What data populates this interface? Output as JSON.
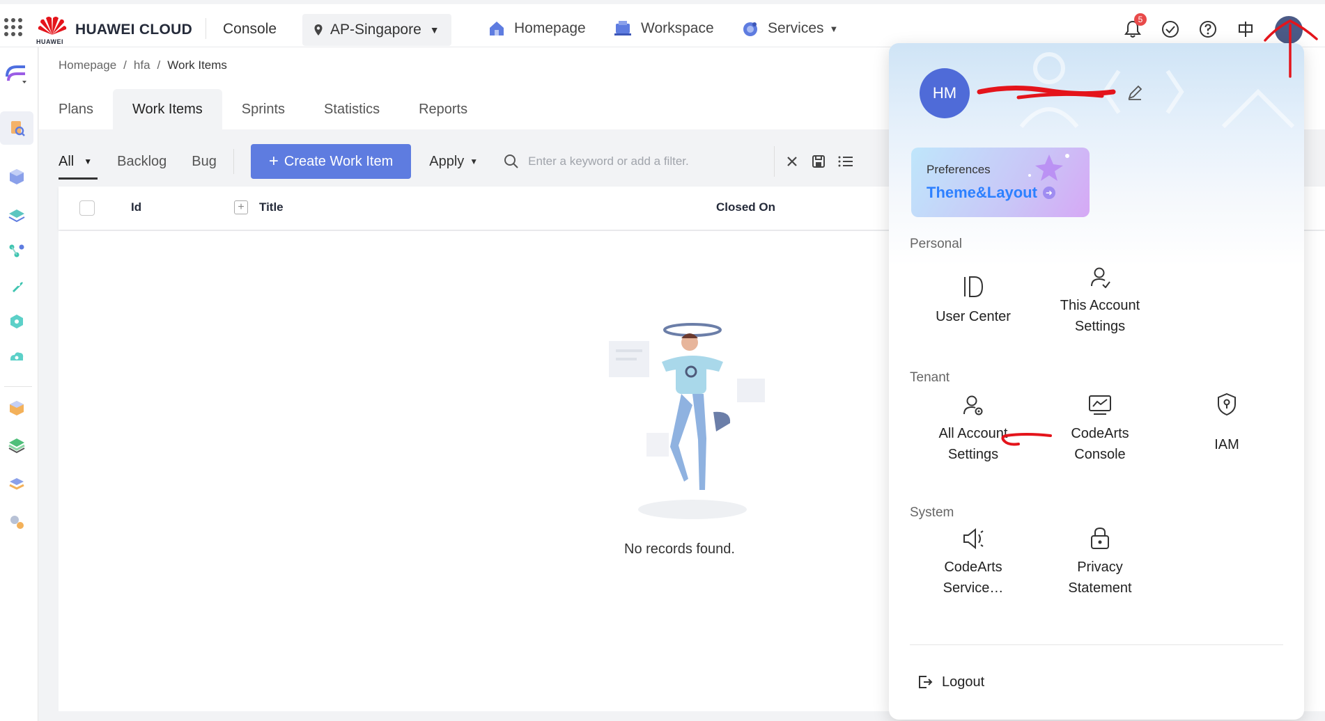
{
  "topbar": {
    "brand": "HUAWEI CLOUD",
    "logo_text": "HUAWEI",
    "console": "Console",
    "region": "AP-Singapore",
    "nav": [
      {
        "label": "Homepage"
      },
      {
        "label": "Workspace"
      },
      {
        "label": "Services"
      }
    ],
    "notification_count": "5"
  },
  "breadcrumb": {
    "items": [
      "Homepage",
      "hfa",
      "Work Items"
    ],
    "separator": "/"
  },
  "tabs": [
    "Plans",
    "Work Items",
    "Sprints",
    "Statistics",
    "Reports"
  ],
  "filter": {
    "types": [
      "All",
      "Backlog",
      "Bug"
    ],
    "create_label": "Create Work Item",
    "apply_label": "Apply",
    "search_placeholder": "Enter a keyword or add a filter."
  },
  "table": {
    "columns": [
      "Id",
      "Title",
      "Closed On"
    ],
    "empty_text": "No records found."
  },
  "popup": {
    "avatar_initials": "HM",
    "preferences_label": "Preferences",
    "theme_label": "Theme&Layout",
    "sections": {
      "personal": "Personal",
      "tenant": "Tenant",
      "system": "System"
    },
    "personal_items": [
      "User Center",
      "This Account Settings"
    ],
    "tenant_items": [
      "All Account Settings",
      "CodeArts Console",
      "IAM"
    ],
    "system_items": [
      "CodeArts Service…",
      "Privacy Statement"
    ],
    "logout_label": "Logout"
  },
  "colors": {
    "primary": "#5e7ce0",
    "badge": "#e84a4a",
    "annotation": "#e4141b"
  }
}
